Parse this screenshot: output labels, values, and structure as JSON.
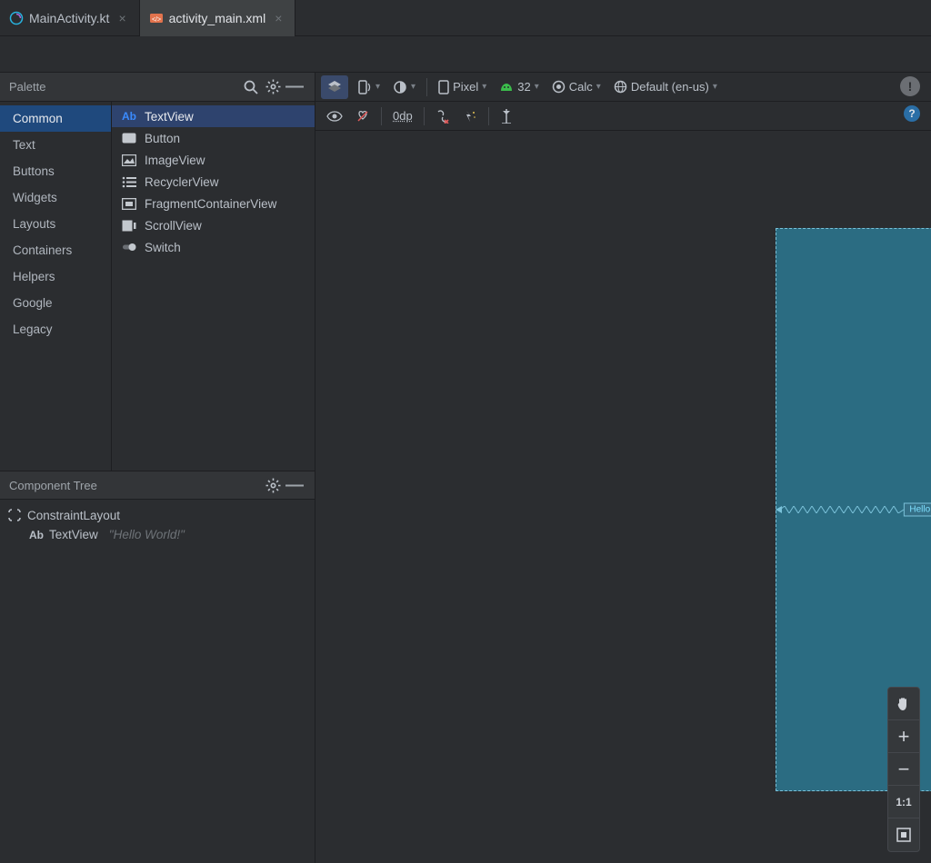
{
  "tabs": [
    {
      "name": "MainActivity.kt",
      "active": false
    },
    {
      "name": "activity_main.xml",
      "active": true
    }
  ],
  "palette": {
    "title": "Palette",
    "categories": [
      "Common",
      "Text",
      "Buttons",
      "Widgets",
      "Layouts",
      "Containers",
      "Helpers",
      "Google",
      "Legacy"
    ],
    "selected_category": "Common",
    "items": [
      {
        "icon": "ab",
        "label": "TextView",
        "selected": true
      },
      {
        "icon": "rect",
        "label": "Button"
      },
      {
        "icon": "image",
        "label": "ImageView"
      },
      {
        "icon": "list",
        "label": "RecyclerView"
      },
      {
        "icon": "fragment",
        "label": "FragmentContainerView"
      },
      {
        "icon": "scroll",
        "label": "ScrollView"
      },
      {
        "icon": "switch",
        "label": "Switch"
      }
    ]
  },
  "component_tree": {
    "title": "Component Tree",
    "root": {
      "icon": "constraint",
      "label": "ConstraintLayout"
    },
    "child": {
      "icon": "ab",
      "label": "TextView",
      "hint": "\"Hello World!\""
    }
  },
  "design_toolbar": {
    "device": "Pixel",
    "api": "32",
    "theme": "Calc",
    "locale": "Default (en-us)",
    "margin": "0dp"
  },
  "canvas": {
    "hello_text": "Hello World!"
  },
  "zoom": {
    "fit_label": "1:1"
  }
}
